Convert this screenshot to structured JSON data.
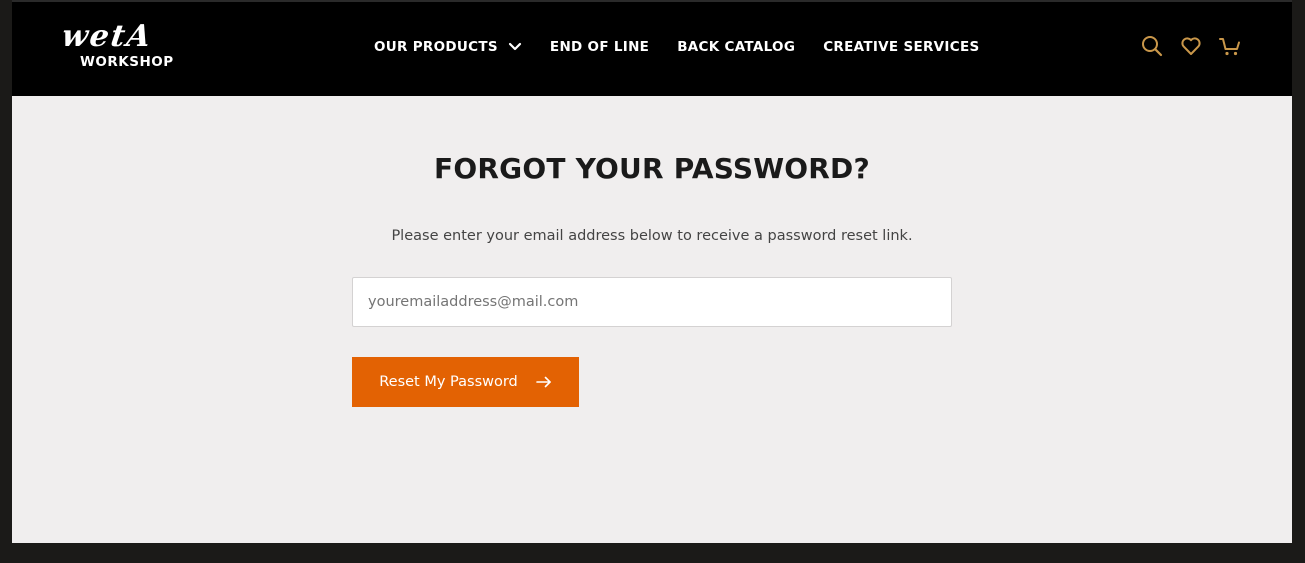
{
  "header": {
    "logo": {
      "top": "wetA",
      "bottom": "WORKSHOP"
    },
    "nav": [
      {
        "label": "OUR PRODUCTS",
        "has_dropdown": true
      },
      {
        "label": "END OF LINE"
      },
      {
        "label": "BACK CATALOG"
      },
      {
        "label": "CREATIVE SERVICES"
      }
    ],
    "icons": [
      "search-icon",
      "heart-icon",
      "cart-icon"
    ],
    "icon_color": "#c9974a"
  },
  "main": {
    "title": "FORGOT YOUR PASSWORD?",
    "description": "Please enter your email address below to receive a password reset link.",
    "email_placeholder": "youremailaddress@mail.com",
    "reset_button_label": "Reset My Password"
  },
  "colors": {
    "accent": "#e36203",
    "header_bg": "#000000",
    "page_bg": "#f0eeee"
  }
}
